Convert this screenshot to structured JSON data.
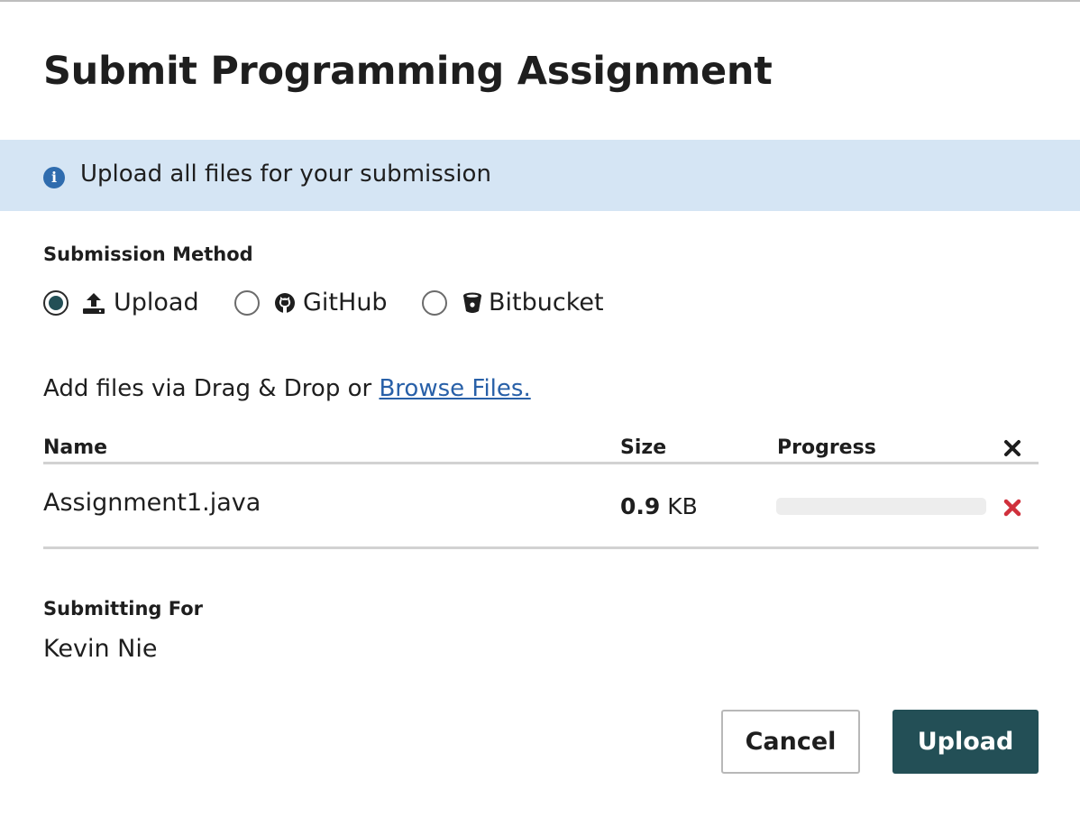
{
  "dialog": {
    "title": "Submit Programming Assignment"
  },
  "banner": {
    "icon": "info-circle-icon",
    "text": "Upload all files for your submission",
    "background": "#d5e5f4"
  },
  "submission_method": {
    "label": "Submission Method",
    "options": [
      {
        "label": "Upload",
        "icon": "upload-icon",
        "checked": true
      },
      {
        "label": "GitHub",
        "icon": "github-icon",
        "checked": false
      },
      {
        "label": "Bitbucket",
        "icon": "bitbucket-icon",
        "checked": false
      }
    ]
  },
  "dropzone": {
    "prefix": "Add files via Drag & Drop or",
    "link": "Browse Files."
  },
  "files_table": {
    "columns": [
      "Name",
      "Size",
      "Progress"
    ],
    "remove_all_icon": "close-icon",
    "rows": [
      {
        "name": "Assignment1.java",
        "size_value": "0.9",
        "size_unit": "KB",
        "progress": 0,
        "remove_icon": "close-icon"
      }
    ]
  },
  "submitting_for": {
    "label": "Submitting For",
    "name": "Kevin Nie"
  },
  "actions": {
    "cancel": "Cancel",
    "upload": "Upload"
  },
  "colors": {
    "primary": "#234f56",
    "link": "#2860a8",
    "danger": "#d0303c",
    "text": "#1e1e1e"
  }
}
